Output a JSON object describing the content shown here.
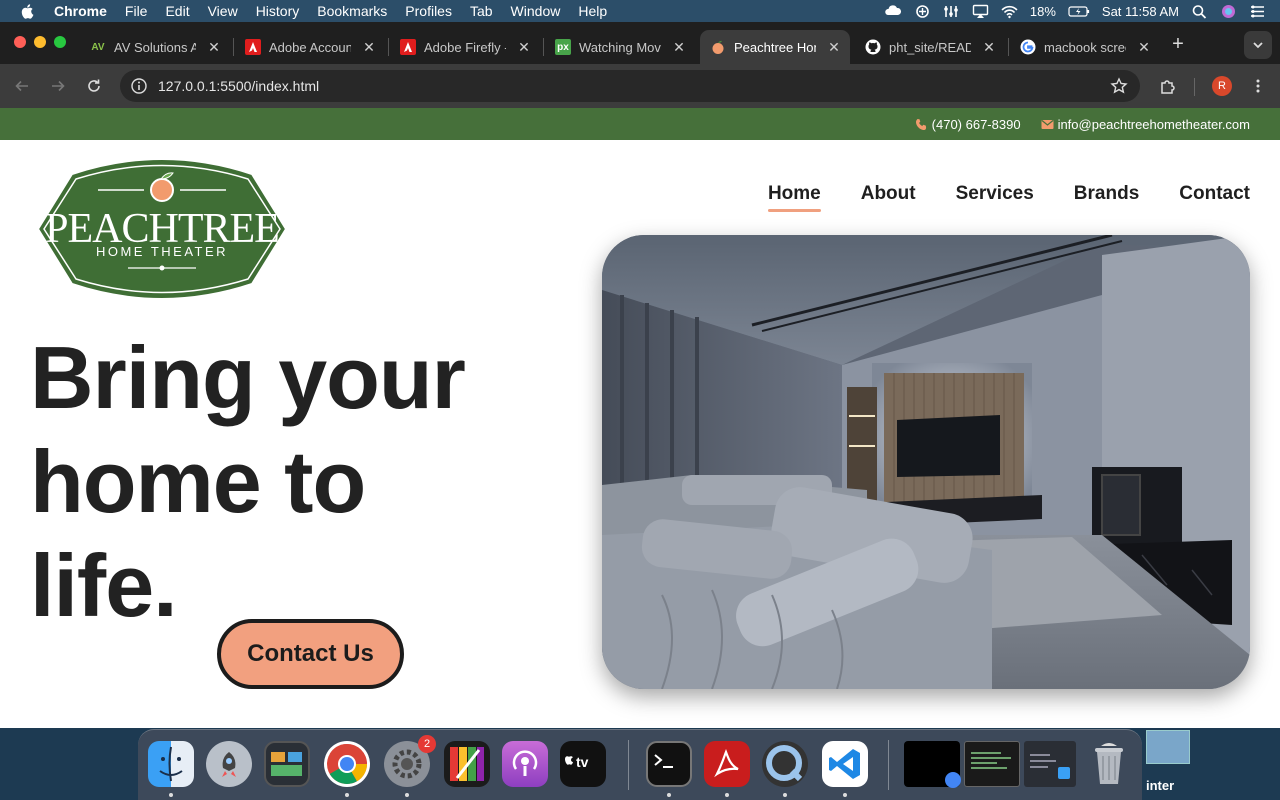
{
  "menubar": {
    "app_name": "Chrome",
    "items": [
      "File",
      "Edit",
      "View",
      "History",
      "Bookmarks",
      "Profiles",
      "Tab",
      "Window",
      "Help"
    ],
    "battery": "18%",
    "clock": "Sat 11:58 AM"
  },
  "tabs": [
    {
      "title": "AV Solutions A",
      "favicon": "AV"
    },
    {
      "title": "Adobe Account",
      "favicon": "adobe-icon"
    },
    {
      "title": "Adobe Firefly -",
      "favicon": "adobe-icon"
    },
    {
      "title": "Watching Movi",
      "favicon": "px"
    },
    {
      "title": "Peachtree Hom",
      "favicon": "peach-icon",
      "active": true
    },
    {
      "title": "pht_site/READ",
      "favicon": "github-icon"
    },
    {
      "title": "macbook scree",
      "favicon": "google-icon"
    }
  ],
  "toolbar": {
    "url": "127.0.0.1:5500/index.html",
    "profile_initial": "R"
  },
  "site": {
    "phone": "(470) 667-8390",
    "email": "info@peachtreehometheater.com",
    "logo_name": "PEACHTREE",
    "logo_sub": "HOME THEATER",
    "nav": [
      "Home",
      "About",
      "Services",
      "Brands",
      "Contact"
    ],
    "nav_active": "Home",
    "hero_lines": [
      "Bring your",
      "home to",
      "life."
    ],
    "cta_label": "Contact Us",
    "colors": {
      "topbar_green": "#46703a",
      "accent_peach": "#f2a07f",
      "text_dark": "#222222"
    }
  },
  "dock": {
    "apps": [
      "finder-icon",
      "launchpad-icon",
      "photo-app-icon",
      "chrome-icon",
      "system-settings-icon",
      "palette-app-icon",
      "podcasts-icon",
      "apple-tv-icon",
      "terminal-icon",
      "acrobat-icon",
      "quicktime-icon",
      "vscode-icon"
    ],
    "settings_badge": "2",
    "desktop_label": "inter"
  }
}
